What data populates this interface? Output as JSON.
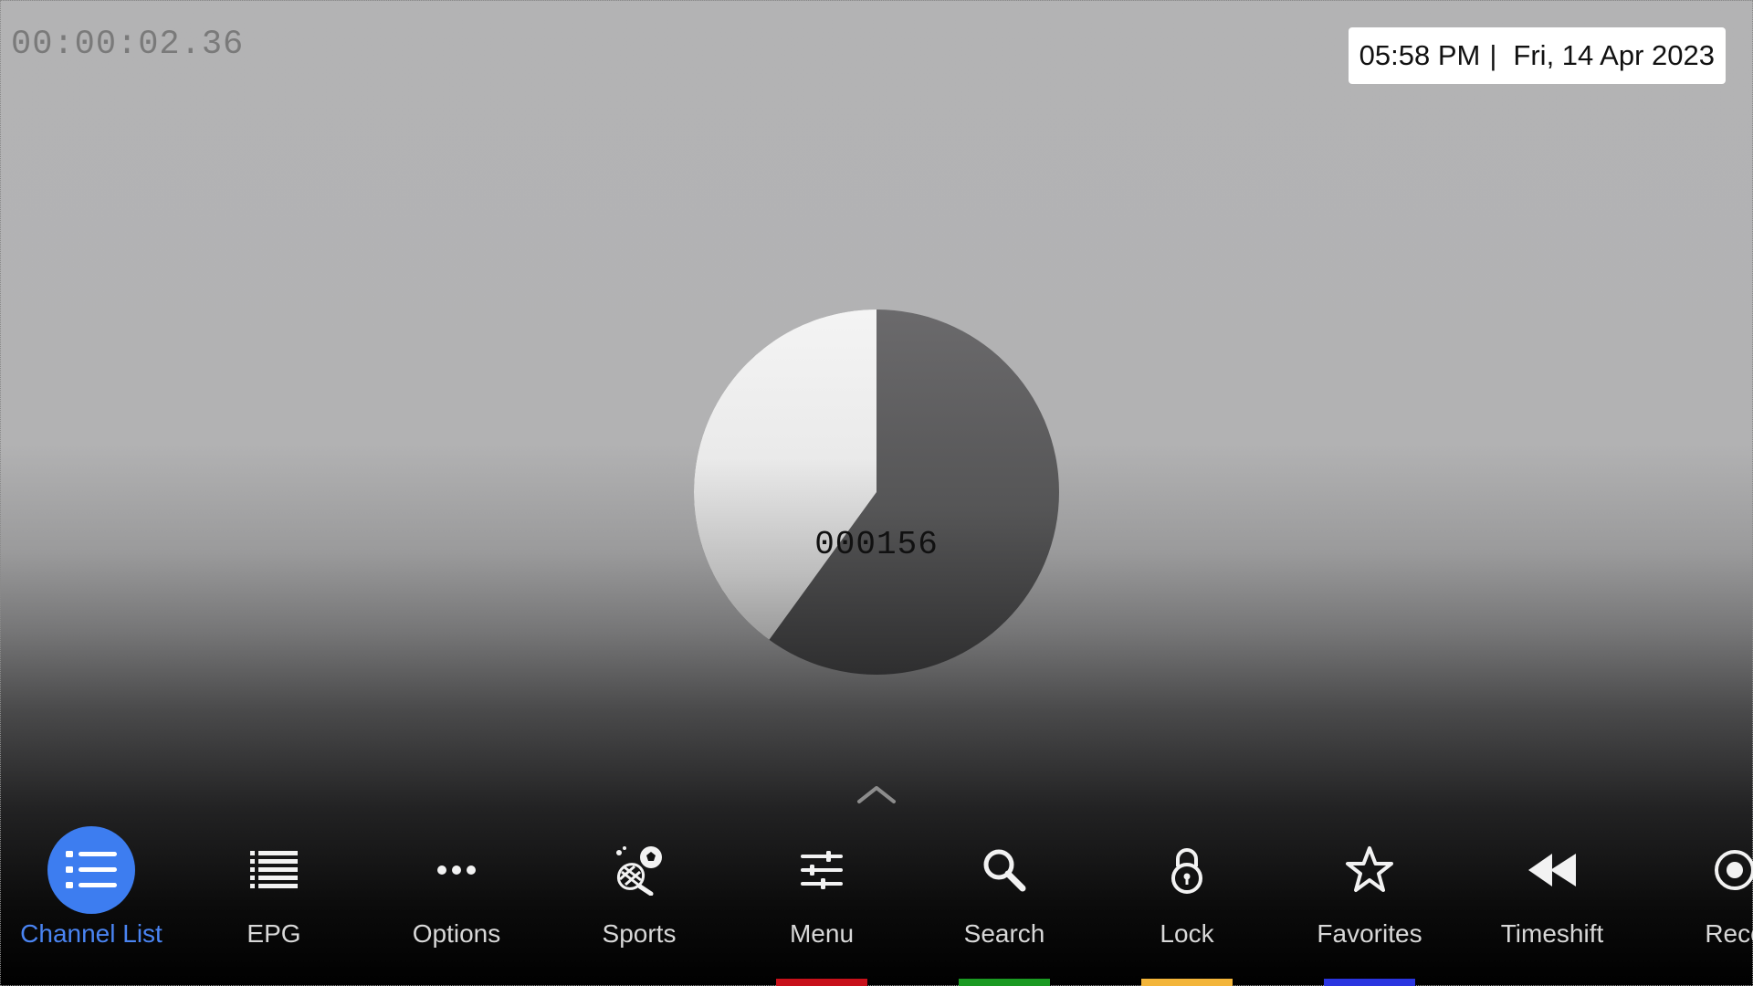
{
  "timecode": "00:00:02.36",
  "clock": {
    "time": "05:58 PM",
    "separator": "|",
    "date": "Fri, 14 Apr 2023"
  },
  "test_pattern": {
    "counter": "000156",
    "progress_fraction": 0.4,
    "colors": {
      "light": "#efefef",
      "dark": "#5b5b5c"
    }
  },
  "toolbar": {
    "active_color": "#3d7df0",
    "items": [
      {
        "label": "Channel List",
        "icon": "list-icon",
        "active": true
      },
      {
        "label": "EPG",
        "icon": "guide-list-icon",
        "active": false
      },
      {
        "label": "Options",
        "icon": "more-dots-icon",
        "active": false
      },
      {
        "label": "Sports",
        "icon": "sports-icon",
        "active": false
      },
      {
        "label": "Menu",
        "icon": "sliders-icon",
        "active": false
      },
      {
        "label": "Search",
        "icon": "search-icon",
        "active": false
      },
      {
        "label": "Lock",
        "icon": "lock-icon",
        "active": false
      },
      {
        "label": "Favorites",
        "icon": "star-icon",
        "active": false
      },
      {
        "label": "Timeshift",
        "icon": "rewind-icon",
        "active": false
      },
      {
        "label": "Reco",
        "icon": "record-icon",
        "active": false
      }
    ],
    "color_keys": [
      {
        "color": "#c8101a"
      },
      {
        "color": "#1a9a22"
      },
      {
        "color": "#f3b53a"
      },
      {
        "color": "#2a35e0"
      }
    ]
  }
}
